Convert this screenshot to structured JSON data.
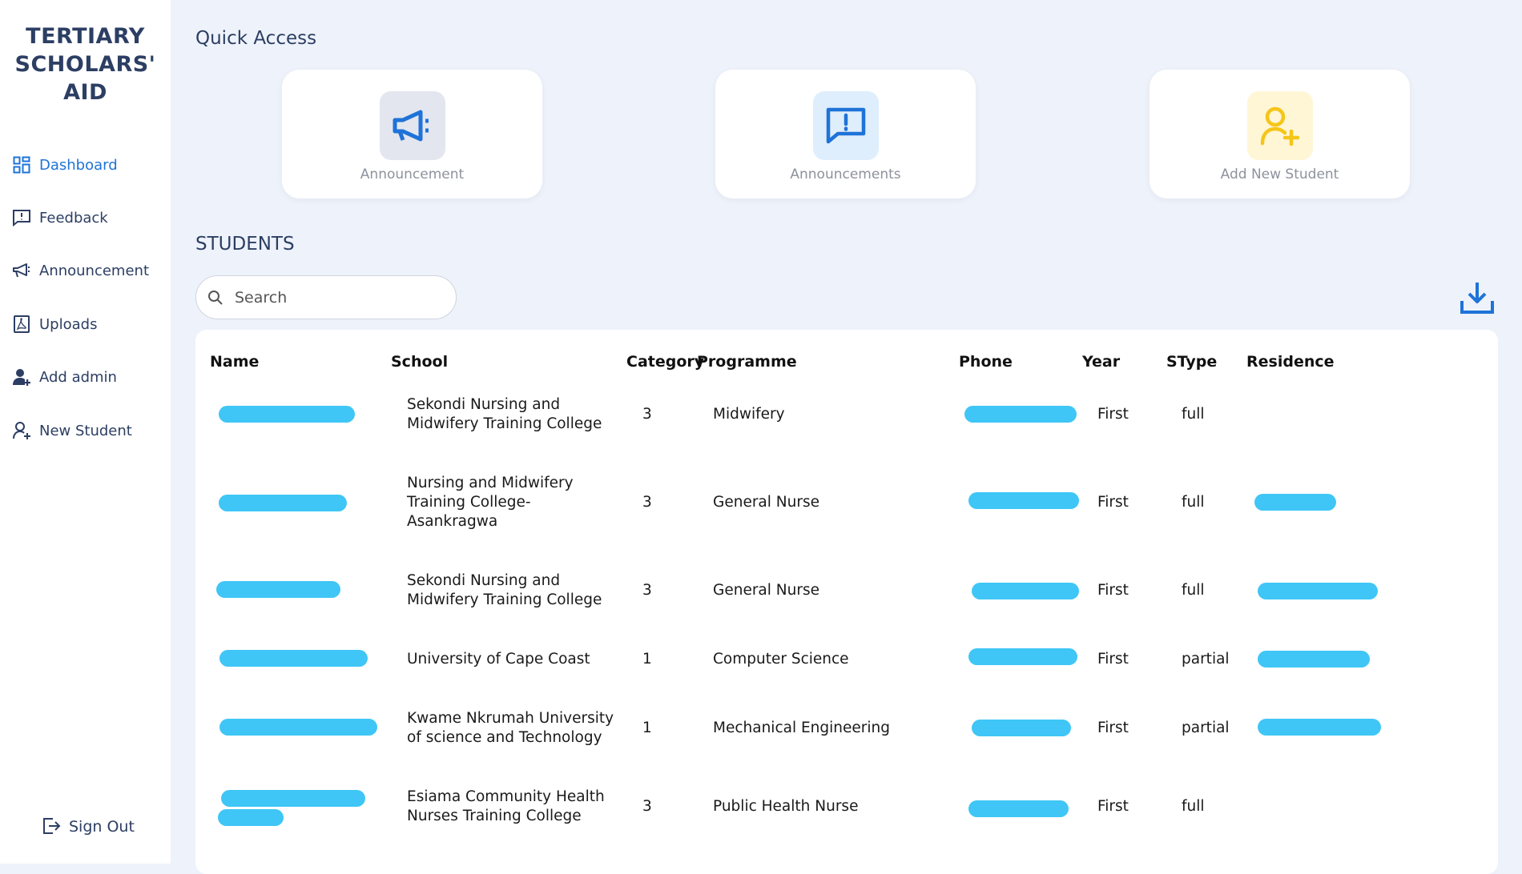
{
  "brand": {
    "line1": "TERTIARY",
    "line2": "SCHOLARS'",
    "line3": "AID"
  },
  "sidebar": {
    "items": [
      {
        "label": "Dashboard",
        "icon": "dashboard-grid-icon",
        "active": true
      },
      {
        "label": "Feedback",
        "icon": "feedback-icon"
      },
      {
        "label": "Announcement",
        "icon": "megaphone-icon"
      },
      {
        "label": "Uploads",
        "icon": "pdf-upload-icon"
      },
      {
        "label": "Add admin",
        "icon": "add-admin-icon"
      },
      {
        "label": "New Student",
        "icon": "add-user-icon"
      }
    ],
    "sign_out": "Sign Out"
  },
  "quick_access": {
    "title": "Quick Access",
    "cards": [
      {
        "label": "Announcement",
        "icon": "megaphone-icon",
        "color": "#1e73d8",
        "bg": "#e4e6ef"
      },
      {
        "label": "Announcements",
        "icon": "message-alert-icon",
        "color": "#1e73d8",
        "bg": "#dfeefc"
      },
      {
        "label": "Add New Student",
        "icon": "add-user-icon",
        "color": "#f5c518",
        "bg": "#fff6d6"
      }
    ]
  },
  "students": {
    "title": "STUDENTS",
    "search_placeholder": "Search",
    "columns": [
      "Name",
      "School",
      "Category",
      "Programme",
      "Phone",
      "Year",
      "SType",
      "Residence"
    ],
    "rows": [
      {
        "school": [
          "Sekondi Nursing and",
          "Midwifery Training College"
        ],
        "category": "3",
        "programme": "Midwifery",
        "year": "First",
        "stype": "full"
      },
      {
        "school": [
          "Nursing and Midwifery",
          "Training College-",
          "Asankragwa"
        ],
        "category": "3",
        "programme": "General Nurse",
        "year": "First",
        "stype": "full"
      },
      {
        "school": [
          "Sekondi Nursing and",
          "Midwifery Training College"
        ],
        "category": "3",
        "programme": "General Nurse",
        "year": "First",
        "stype": "full"
      },
      {
        "school": [
          "University of Cape Coast"
        ],
        "category": "1",
        "programme": "Computer Science",
        "year": "First",
        "stype": "partial"
      },
      {
        "school": [
          "Kwame Nkrumah University",
          "of science and Technology"
        ],
        "category": "1",
        "programme": "Mechanical Engineering",
        "year": "First",
        "stype": "partial"
      },
      {
        "school": [
          "Esiama Community Health",
          "Nurses Training College"
        ],
        "category": "3",
        "programme": "Public Health Nurse",
        "year": "First",
        "stype": "full"
      }
    ]
  },
  "colors": {
    "accent": "#1e73d8",
    "redaction": "#3fc6f6",
    "sidebar_text": "#2c3e63"
  }
}
